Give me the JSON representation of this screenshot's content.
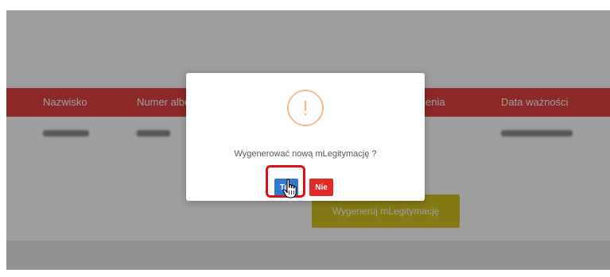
{
  "table": {
    "headers": [
      "Nazwisko",
      "Numer albu",
      "enia",
      "Data ważności"
    ]
  },
  "generate_button_label": "Wygeneruj mLegitymację",
  "dialog": {
    "icon": "warning-exclamation-icon",
    "icon_glyph": "!",
    "message": "Wygenerować nową mLegitymację ?",
    "confirm_label": "Tak",
    "cancel_label": "Nie",
    "icon_color": "#f8bb86",
    "confirm_color": "#2f7ad0",
    "cancel_color": "#e52a2a"
  },
  "annotation": {
    "highlight_color": "#e0101a",
    "cursor": "hand-pointer-icon"
  },
  "colors": {
    "table_header": "#e24141",
    "generate_button": "#d6c322"
  }
}
